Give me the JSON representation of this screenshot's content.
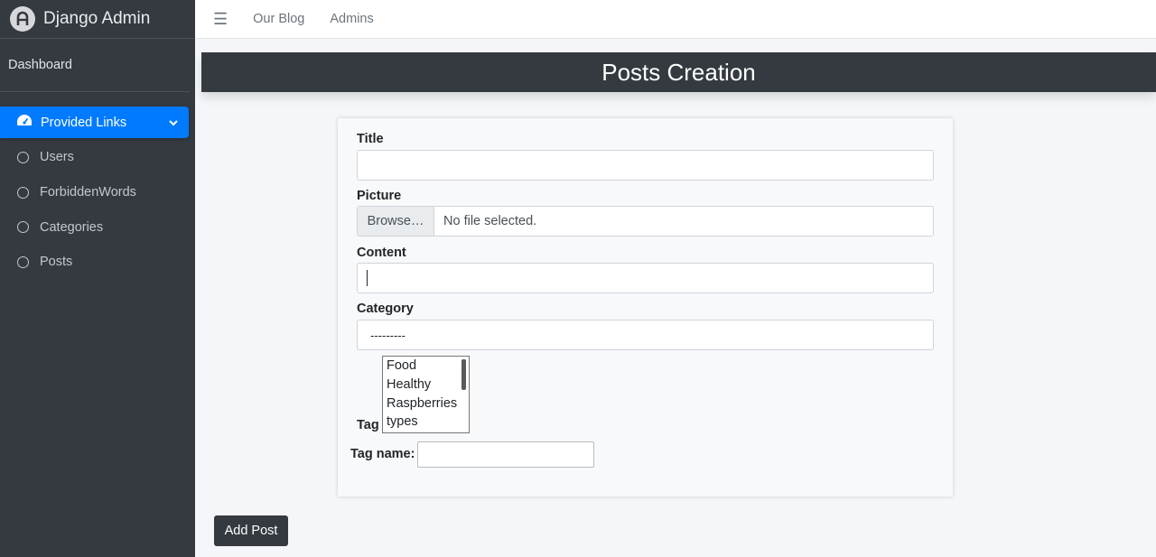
{
  "brand": {
    "title": "Django Admin"
  },
  "sidebar": {
    "dashboard": "Dashboard",
    "section": "Provided Links",
    "items": [
      {
        "label": "Users"
      },
      {
        "label": "ForbiddenWords"
      },
      {
        "label": "Categories"
      },
      {
        "label": "Posts"
      }
    ]
  },
  "topbar": {
    "links": [
      "Our Blog",
      "Admins"
    ]
  },
  "page": {
    "title": "Posts Creation"
  },
  "form": {
    "title_label": "Title",
    "title_value": "",
    "picture_label": "Picture",
    "browse_label": "Browse…",
    "no_file_text": "No file selected.",
    "content_label": "Content",
    "content_value": "",
    "category_label": "Category",
    "category_selected": "---------",
    "tag_label": "Tag",
    "tag_options": [
      "Food",
      "Healthy",
      "Raspberries",
      "types"
    ],
    "tag_name_label": "Tag name:",
    "tag_name_value": "",
    "submit_label": "Add Post"
  },
  "colors": {
    "sidebar_bg": "#343a40",
    "accent": "#007bff",
    "header_bg": "#343a40"
  }
}
